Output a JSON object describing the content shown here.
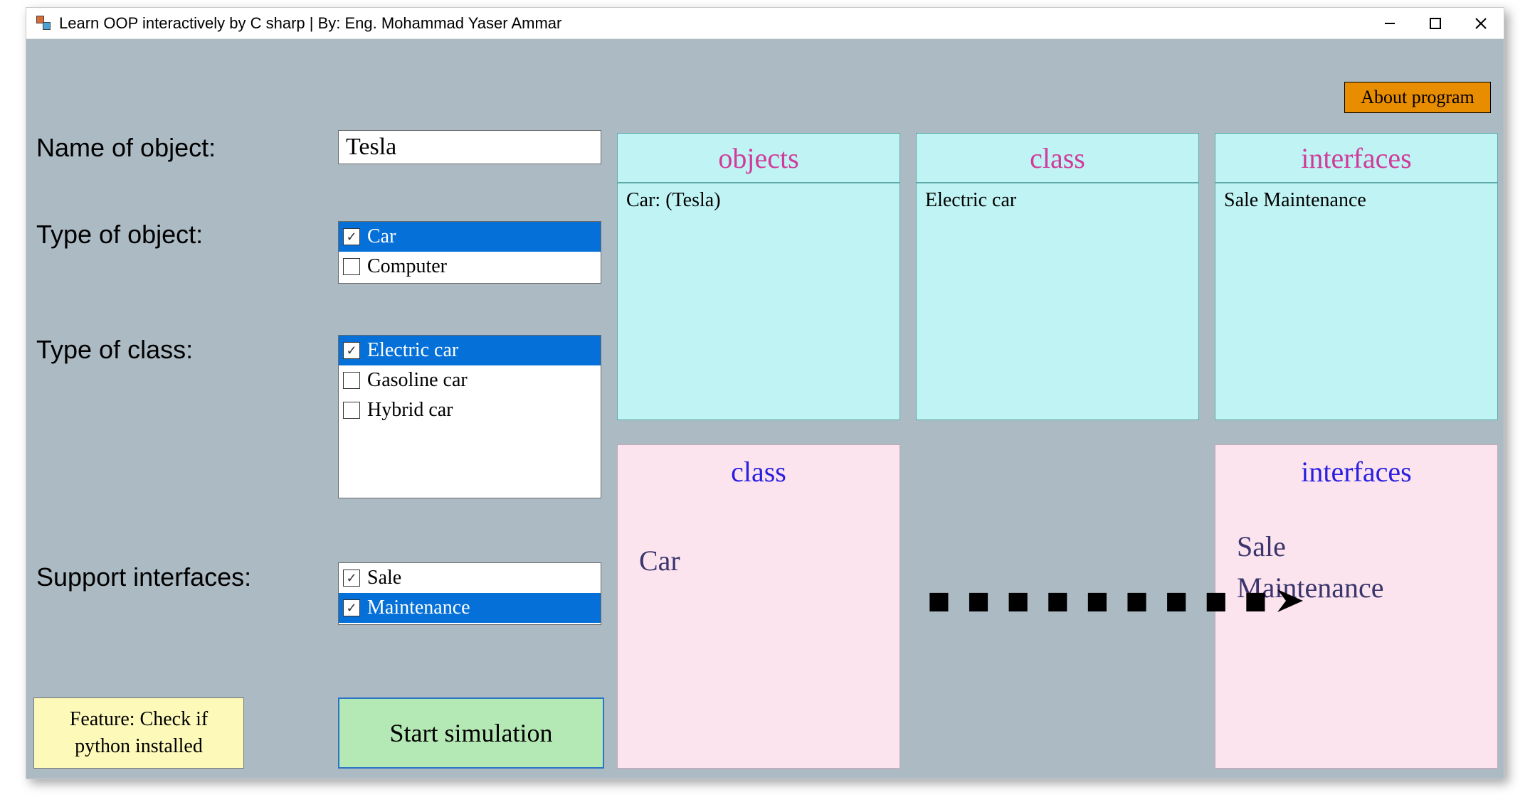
{
  "window": {
    "title": "Learn OOP interactively by C sharp | By: Eng. Mohammad Yaser Ammar"
  },
  "about_button": "About program",
  "labels": {
    "name": "Name of object:",
    "type_object": "Type of object:",
    "type_class": "Type of class:",
    "support_interfaces": "Support interfaces:"
  },
  "object_name_value": "Tesla",
  "type_object_options": [
    {
      "label": "Car",
      "checked": true,
      "selected": true
    },
    {
      "label": "Computer",
      "checked": false,
      "selected": false
    }
  ],
  "type_class_options": [
    {
      "label": "Electric car",
      "checked": true,
      "selected": true
    },
    {
      "label": "Gasoline car",
      "checked": false,
      "selected": false
    },
    {
      "label": "Hybrid car",
      "checked": false,
      "selected": false
    }
  ],
  "interface_options": [
    {
      "label": "Sale",
      "checked": true,
      "selected": false
    },
    {
      "label": "Maintenance",
      "checked": true,
      "selected": true
    }
  ],
  "start_button": "Start simulation",
  "feature_button": "Feature: Check if python installed",
  "panels_top": {
    "objects": {
      "title": "objects",
      "content": "Car: (Tesla)"
    },
    "class": {
      "title": "class",
      "content": "Electric car"
    },
    "interfaces": {
      "title": "interfaces",
      "content": "Sale Maintenance"
    }
  },
  "panels_bottom": {
    "class": {
      "title": "class",
      "lines": [
        "Car"
      ]
    },
    "interfaces": {
      "title": "interfaces",
      "lines": [
        "Sale",
        "Maintenance"
      ]
    }
  }
}
